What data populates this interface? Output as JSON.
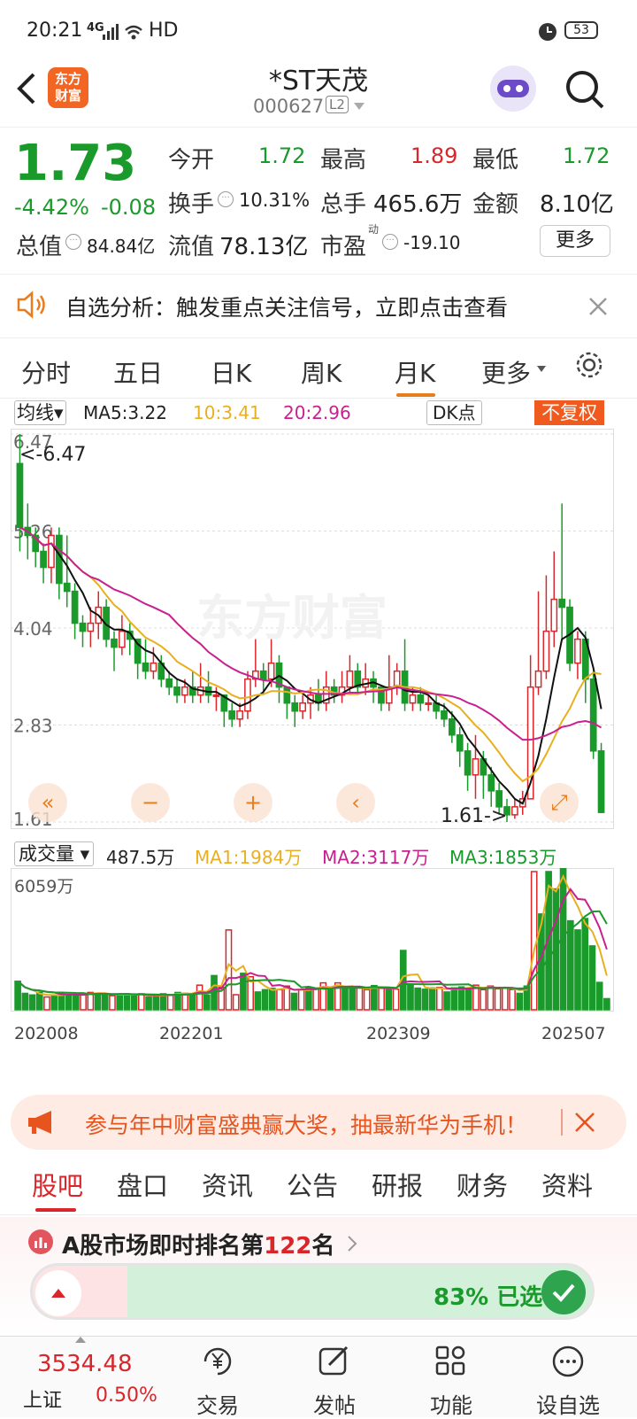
{
  "status": {
    "time": "20:21",
    "network": "4G",
    "hd": "HD",
    "battery": "53"
  },
  "header": {
    "back_icon": "back-arrow-icon",
    "logo_line1": "东方",
    "logo_line2": "财富",
    "name": "*ST天茂",
    "code": "000627",
    "level": "L2"
  },
  "quote": {
    "price": "1.73",
    "change_pct": "-4.42%",
    "change": "-0.08",
    "open_label": "今开",
    "open": "1.72",
    "high_label": "最高",
    "high": "1.89",
    "low_label": "最低",
    "low": "1.72",
    "turnover_label": "换手",
    "turnover": "10.31%",
    "volume_label": "总手",
    "volume": "465.6万",
    "amount_label": "金额",
    "amount": "8.10亿",
    "mcap_label": "总值",
    "mcap": "84.84亿",
    "float_label": "流值",
    "float": "78.13亿",
    "pe_label": "市盈",
    "pe_sup": "动",
    "pe": "-19.10",
    "more": "更多"
  },
  "notice": {
    "text": "自选分析：触发重点关注信号，立即点击查看"
  },
  "tabs": [
    "分时",
    "五日",
    "日K",
    "周K",
    "月K",
    "更多"
  ],
  "active_tab": "月K",
  "chart": {
    "ma_selector": "均线",
    "ma5": "MA5:3.22",
    "ma10": "10:3.41",
    "ma20": "20:2.96",
    "dk": "DK点",
    "fq": "不复权",
    "price_labels": [
      "6.47",
      "5.26",
      "4.04",
      "2.83",
      "1.61"
    ],
    "max_note": "<-6.47",
    "min_note": "1.61->",
    "vol_selector": "成交量",
    "vol": "487.5万",
    "vma1": "MA1:1984万",
    "vma2": "MA2:3117万",
    "vma3": "MA3:1853万",
    "vol_max": "6059万",
    "dates": [
      "202008",
      "202201",
      "202309",
      "202507"
    ],
    "watermark": "东方财富",
    "colors": {
      "up": "#d9262b",
      "down": "#1a9a2a",
      "ma5": "#111111",
      "ma10": "#e8b020",
      "ma20": "#c8208f"
    }
  },
  "chart_data": {
    "type": "candlestick",
    "period": "monthly",
    "ylim": [
      1.61,
      6.47
    ],
    "candles": [
      [
        6.1,
        5.3,
        6.47,
        5.0
      ],
      [
        5.3,
        5.2,
        5.6,
        4.9
      ],
      [
        5.2,
        5.0,
        5.3,
        4.8
      ],
      [
        5.0,
        4.8,
        5.1,
        4.6
      ],
      [
        4.8,
        5.2,
        5.3,
        4.6
      ],
      [
        5.2,
        4.6,
        5.3,
        4.4
      ],
      [
        4.6,
        4.5,
        5.2,
        4.3
      ],
      [
        4.5,
        4.1,
        4.6,
        3.9
      ],
      [
        4.1,
        4.0,
        4.2,
        3.8
      ],
      [
        4.0,
        4.1,
        4.3,
        3.8
      ],
      [
        4.1,
        4.3,
        4.5,
        3.9
      ],
      [
        4.3,
        3.9,
        4.4,
        3.8
      ],
      [
        3.9,
        3.8,
        4.0,
        3.5
      ],
      [
        3.8,
        4.0,
        4.2,
        3.7
      ],
      [
        4.0,
        3.9,
        4.1,
        3.7
      ],
      [
        3.9,
        3.6,
        3.9,
        3.4
      ],
      [
        3.6,
        3.5,
        3.9,
        3.4
      ],
      [
        3.5,
        3.6,
        3.8,
        3.4
      ],
      [
        3.6,
        3.4,
        3.7,
        3.3
      ],
      [
        3.4,
        3.3,
        3.5,
        3.2
      ],
      [
        3.3,
        3.2,
        3.4,
        3.1
      ],
      [
        3.2,
        3.3,
        3.4,
        3.1
      ],
      [
        3.3,
        3.2,
        3.5,
        3.1
      ],
      [
        3.2,
        3.3,
        3.6,
        3.1
      ],
      [
        3.3,
        3.2,
        3.5,
        3.1
      ],
      [
        3.2,
        3.2,
        3.3,
        3.0
      ],
      [
        3.2,
        3.0,
        3.2,
        2.8
      ],
      [
        3.0,
        2.9,
        3.1,
        2.8
      ],
      [
        2.9,
        3.0,
        3.1,
        2.8
      ],
      [
        3.0,
        3.4,
        3.5,
        2.9
      ],
      [
        3.4,
        3.5,
        3.9,
        3.3
      ],
      [
        3.5,
        3.4,
        3.6,
        3.2
      ],
      [
        3.4,
        3.6,
        3.9,
        3.3
      ],
      [
        3.6,
        3.3,
        3.7,
        3.1
      ],
      [
        3.3,
        3.1,
        3.3,
        2.9
      ],
      [
        3.1,
        3.0,
        3.2,
        2.8
      ],
      [
        3.0,
        3.1,
        3.2,
        2.9
      ],
      [
        3.1,
        3.2,
        3.3,
        2.9
      ],
      [
        3.2,
        3.1,
        3.4,
        3.0
      ],
      [
        3.1,
        3.3,
        3.5,
        3.0
      ],
      [
        3.3,
        3.2,
        3.4,
        3.1
      ],
      [
        3.2,
        3.3,
        3.5,
        3.1
      ],
      [
        3.3,
        3.5,
        3.7,
        3.2
      ],
      [
        3.5,
        3.3,
        3.6,
        3.2
      ],
      [
        3.3,
        3.4,
        3.6,
        3.2
      ],
      [
        3.4,
        3.3,
        3.5,
        3.1
      ],
      [
        3.3,
        3.1,
        3.3,
        3.0
      ],
      [
        3.1,
        3.3,
        3.7,
        3.0
      ],
      [
        3.3,
        3.5,
        3.6,
        3.2
      ],
      [
        3.5,
        3.1,
        3.9,
        3.0
      ],
      [
        3.1,
        3.2,
        3.3,
        3.0
      ],
      [
        3.2,
        3.1,
        3.3,
        3.0
      ],
      [
        3.1,
        3.1,
        3.2,
        3.0
      ],
      [
        3.1,
        3.0,
        3.2,
        2.9
      ],
      [
        3.0,
        2.9,
        3.1,
        2.8
      ],
      [
        2.9,
        2.7,
        3.0,
        2.6
      ],
      [
        2.7,
        2.5,
        2.8,
        2.3
      ],
      [
        2.5,
        2.2,
        2.6,
        2.0
      ],
      [
        2.2,
        2.4,
        2.7,
        1.9
      ],
      [
        2.4,
        2.2,
        2.5,
        1.9
      ],
      [
        2.2,
        2.0,
        2.3,
        1.8
      ],
      [
        2.0,
        1.8,
        2.1,
        1.7
      ],
      [
        1.8,
        1.7,
        1.9,
        1.61
      ],
      [
        1.7,
        1.8,
        1.9,
        1.65
      ],
      [
        1.8,
        1.9,
        2.0,
        1.7
      ],
      [
        1.9,
        3.3,
        3.7,
        1.9
      ],
      [
        3.3,
        3.5,
        4.5,
        3.2
      ],
      [
        3.5,
        4.0,
        4.7,
        3.4
      ],
      [
        4.0,
        4.4,
        5.0,
        3.8
      ],
      [
        4.4,
        4.3,
        5.6,
        3.9
      ],
      [
        4.3,
        3.6,
        4.4,
        3.5
      ],
      [
        3.6,
        3.9,
        4.0,
        3.4
      ],
      [
        3.9,
        3.4,
        4.0,
        3.1
      ],
      [
        3.4,
        2.5,
        3.5,
        2.4
      ],
      [
        2.5,
        1.73,
        2.6,
        1.72
      ]
    ],
    "volumes": [
      1250,
      720,
      650,
      760,
      560,
      630,
      720,
      680,
      650,
      700,
      760,
      720,
      700,
      620,
      660,
      700,
      640,
      700,
      560,
      620,
      700,
      640,
      760,
      720,
      660,
      1080,
      640,
      1500,
      980,
      3500,
      660,
      1600,
      1450,
      780,
      880,
      940,
      880,
      1040,
      720,
      880,
      960,
      920,
      1180,
      880,
      1180,
      980,
      940,
      960,
      880,
      1060,
      940,
      880,
      900,
      2600,
      1100,
      950,
      900,
      960,
      980,
      780,
      960,
      1000,
      920,
      1080,
      880,
      1040,
      920,
      980,
      890,
      720,
      1040,
      6059,
      4200,
      6059,
      5300,
      6200,
      3900,
      3500,
      4000,
      2800,
      1200,
      487
    ],
    "series_names": [
      "MA5",
      "MA10",
      "MA20"
    ],
    "x_ticks": [
      "202008",
      "202201",
      "202309",
      "202507"
    ]
  },
  "promo": {
    "text": "参与年中财富盛典赢大奖，抽最新华为手机！"
  },
  "subtabs": [
    "股吧",
    "盘口",
    "资讯",
    "公告",
    "研报",
    "财务",
    "资料"
  ],
  "active_subtab": "股吧",
  "rank": {
    "prefix": "A股市场即时排名第",
    "num": "122",
    "suffix": "名",
    "progress_text": "83% 已选",
    "progress_pct": 83
  },
  "bottom": {
    "index_value": "3534.48",
    "index_name": "上证",
    "index_pct": "0.50%",
    "items": [
      "交易",
      "发帖",
      "功能",
      "设自选"
    ]
  }
}
